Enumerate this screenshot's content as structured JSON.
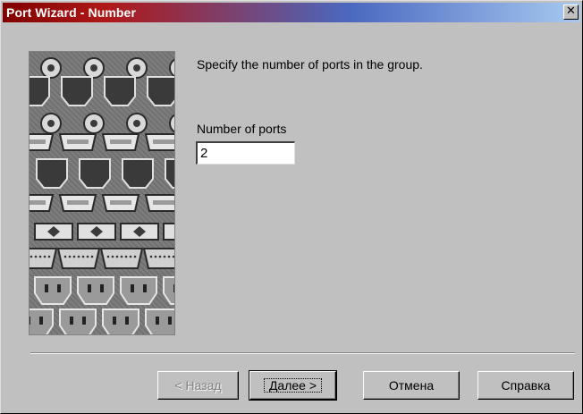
{
  "window": {
    "title": "Port Wizard - Number",
    "close_glyph": "✕"
  },
  "content": {
    "instruction": "Specify the number of ports in the group.",
    "field_label": "Number of ports",
    "ports_value": "2"
  },
  "buttons": {
    "back": "< Назад",
    "next": "Далее >",
    "cancel": "Отмена",
    "help": "Справка"
  },
  "icons": {
    "close": "close-icon",
    "wizard_image": "port-connectors-illustration"
  }
}
